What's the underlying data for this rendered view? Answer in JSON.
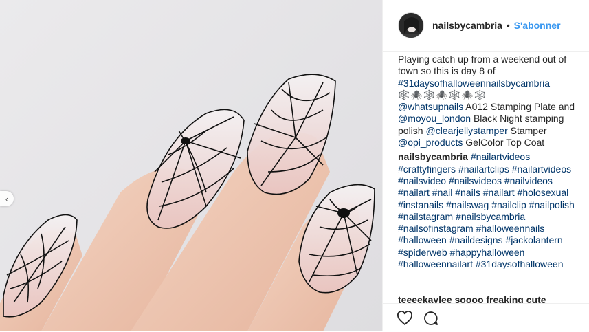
{
  "post": {
    "username": "nailsbycambria",
    "separator": "•",
    "follow_label": "S'abonner"
  },
  "caption": {
    "line1": "Playing catch up from a weekend out of town so this is day 8 of",
    "hashtag_day": "#31daysofhalloweennailsbycambria",
    "emoji": "🕸️🕷️🕸️🕷️🕸️🕷️🕸️",
    "mention1": "@whatsupnails",
    "text1": " A012 Stamping Plate and",
    "mention2": "@moyou_london",
    "text2": " Black Night stamping polish",
    "mention3": "@clearjellystamper",
    "text3": " Stamper",
    "mention4": "@opi_products",
    "text4": " GelColor Top Coat"
  },
  "comment": {
    "username": "nailsbycambria",
    "hashtags": "#nailartvideos #craftyfingers #nailartclips #nailartvideos #nailsvideo #nailsvideos #nailvideos #nailart #nail #nails #nailart #holosexual #instanails #nailswag #nailclip #nailpolish #nailstagram #nailsbycambria #nailsofinstagram #halloweennails #halloween #naildesigns #jackolantern #spiderweb #happyhalloween #halloweennailart #31daysofhalloween"
  },
  "next_comment_partial": "teeeekaylee  soooo freaking cute",
  "icons": {
    "like": "heart-icon",
    "comment": "comment-icon",
    "prev": "chevron-left-icon"
  },
  "colors": {
    "link": "#003569",
    "follow": "#3897f0",
    "text": "#262626"
  }
}
